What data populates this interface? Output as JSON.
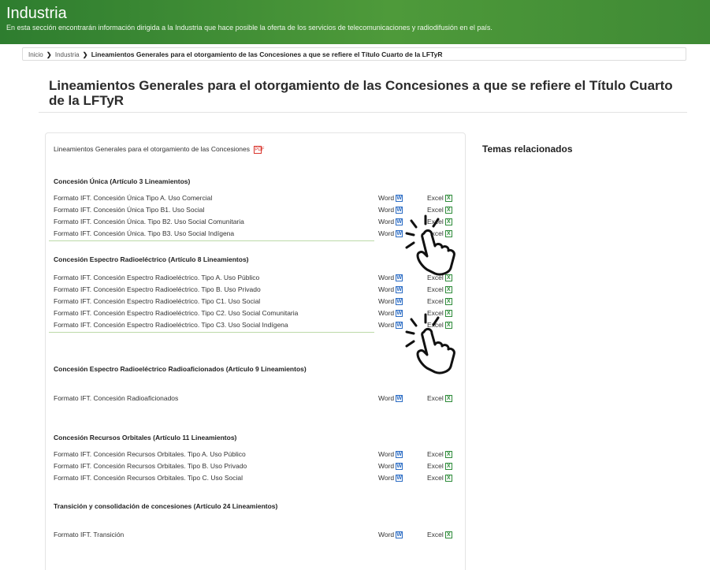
{
  "header": {
    "title": "Industria",
    "description": "En esta sección encontrarán información dirigida a la Industria que hace posible la oferta de los servicios de telecomunicaciones y radiodifusión en el país."
  },
  "breadcrumb": {
    "home": "Inicio",
    "section": "Industria",
    "current": "Lineamientos Generales para el otorgamiento de las Concesiones a que se refiere el Título Cuarto de la LFTyR"
  },
  "page_title": "Lineamientos Generales para el otorgamiento de las Concesiones a que se refiere el Título Cuarto de la LFTyR",
  "main_document": {
    "label": "Lineamientos Generales para el otorgamiento de las Concesiones",
    "icon": "pdf-icon"
  },
  "sidebar": {
    "title": "Temas relacionados"
  },
  "download_labels": {
    "word": "Word",
    "excel": "Excel",
    "word_icon": "W",
    "excel_icon": "X"
  },
  "sections": [
    {
      "heading": "Concesión Única (Artículo 3 Lineamientos)",
      "rows": [
        "Formato IFT.  Concesión Única Tipo A. Uso Comercial",
        "Formato IFT.  Concesión Única Tipo B1. Uso Social",
        "Formato IFT.  Concesión Única. Tipo B2. Uso Social Comunitaria",
        "Formato IFT.  Concesión Única. Tipo B3. Uso Social Indígena"
      ]
    },
    {
      "heading": "Concesión Espectro Radioeléctrico (Artículo 8 Lineamientos)",
      "rows": [
        "Formato IFT.  Concesión Espectro Radioeléctrico. Tipo A. Uso Público",
        "Formato IFT.  Concesión Espectro Radioeléctrico. Tipo B. Uso Privado",
        "Formato IFT.  Concesión Espectro Radioeléctrico. Tipo C1. Uso Social",
        "Formato IFT.  Concesión Espectro Radioeléctrico. Tipo C2. Uso Social Comunitaria",
        "Formato IFT.  Concesión Espectro Radioeléctrico. Tipo C3. Uso Social Indígena"
      ]
    },
    {
      "heading": "Concesión Espectro Radioeléctrico Radioaficionados (Artículo 9 Lineamientos)",
      "rows": [
        "Formato IFT.  Concesión Radioaficionados"
      ]
    },
    {
      "heading": "Concesión Recursos Orbitales (Artículo 11 Lineamientos)",
      "rows": [
        "Formato IFT.  Concesión Recursos Orbitales. Tipo A. Uso Público",
        "Formato IFT.  Concesión Recursos Orbitales. Tipo B. Uso Privado",
        "Formato IFT.  Concesión Recursos Orbitales. Tipo C. Uso Social"
      ]
    },
    {
      "heading": "Transición y consolidación de concesiones (Artículo 24 Lineamientos)",
      "rows": [
        "Formato IFT.  Transición"
      ]
    }
  ],
  "theme": {
    "banner_green": "#3f8a35",
    "word_blue": "#2b6cc4",
    "excel_green": "#2e8b3a",
    "pdf_red": "#d9332b"
  }
}
